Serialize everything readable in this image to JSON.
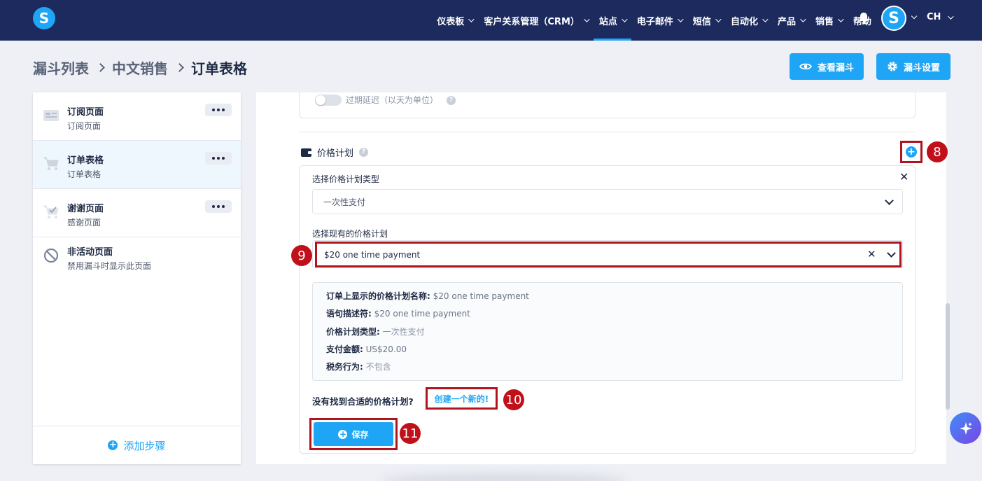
{
  "nav": {
    "logo_letter": "S",
    "items": [
      {
        "label": "仪表板",
        "dropdown": true
      },
      {
        "label": "客户关系管理（CRM）",
        "dropdown": true
      },
      {
        "label": "站点",
        "dropdown": true,
        "active": true
      },
      {
        "label": "电子邮件",
        "dropdown": true
      },
      {
        "label": "短信",
        "dropdown": true
      },
      {
        "label": "自动化",
        "dropdown": true
      },
      {
        "label": "产品",
        "dropdown": true
      },
      {
        "label": "销售",
        "dropdown": true
      },
      {
        "label": "帮助",
        "dropdown": false
      }
    ],
    "avatar_letter": "S",
    "language": "CH",
    "accent_color": "#1ea5f5",
    "bar_color": "#1c2a5e"
  },
  "breadcrumb": {
    "items": [
      "漏斗列表",
      "中文销售"
    ],
    "current": "订单表格"
  },
  "header_buttons": {
    "view_funnel": "查看漏斗",
    "funnel_settings": "漏斗设置"
  },
  "sidebar": {
    "steps": [
      {
        "title": "订阅页面",
        "subtitle": "订阅页面",
        "icon": "form-page-icon"
      },
      {
        "title": "订单表格",
        "subtitle": "订单表格",
        "icon": "cart-icon"
      },
      {
        "title": "谢谢页面",
        "subtitle": "感谢页面",
        "icon": "cart-check-icon"
      },
      {
        "title": "非活动页面",
        "subtitle": "禁用漏斗时显示此页面",
        "icon": "ban-icon"
      }
    ],
    "add_step": "添加步骤"
  },
  "main": {
    "expiry_toggle_label": "过期延迟（以天为单位）",
    "price_plan_title": "价格计划",
    "select_type_label": "选择价格计划类型",
    "select_type_value": "一次性支付",
    "select_existing_label": "选择现有的价格计划",
    "select_existing_value": "$20 one time payment",
    "info": {
      "name_key": "订单上显示的价格计划名称:",
      "name_value": "$20 one time payment",
      "descriptor_key": "语句描述符:",
      "descriptor_value": "$20 one time payment",
      "type_key": "价格计划类型:",
      "type_value": "一次性支付",
      "amount_key": "支付金额:",
      "amount_value": "US$20.00",
      "tax_key": "税务行为:",
      "tax_value": "不包含"
    },
    "not_found_text": "没有找到合适的价格计划?",
    "create_new": "创建一个新的!",
    "save_label": "保存"
  },
  "badges": {
    "add_plan": "8",
    "existing_plan": "9",
    "create_new": "10",
    "save": "11"
  }
}
